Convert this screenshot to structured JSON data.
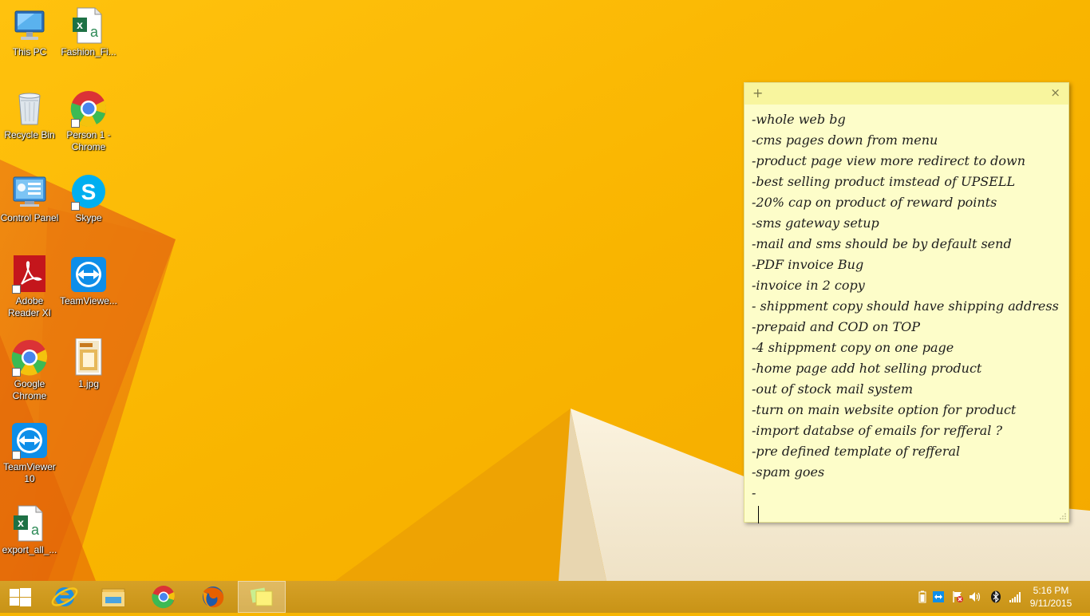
{
  "desktop_icons": [
    {
      "label": "This PC",
      "icon": "this-pc-icon"
    },
    {
      "label": "Fashion_Fi...",
      "icon": "excel-file-icon"
    },
    {
      "label": "Recycle Bin",
      "icon": "recycle-bin-icon"
    },
    {
      "label": "Person 1 - Chrome",
      "icon": "chrome-icon"
    },
    {
      "label": "Control Panel",
      "icon": "control-panel-icon"
    },
    {
      "label": "Skype",
      "icon": "skype-icon"
    },
    {
      "label": "Adobe Reader XI",
      "icon": "adobe-reader-icon"
    },
    {
      "label": "TeamViewe...",
      "icon": "teamviewer-icon"
    },
    {
      "label": "Google Chrome",
      "icon": "chrome-icon"
    },
    {
      "label": "1.jpg",
      "icon": "image-file-icon"
    },
    {
      "label": "TeamViewer 10",
      "icon": "teamviewer-icon"
    },
    {
      "label": "export_all_...",
      "icon": "excel-file-icon"
    }
  ],
  "sticky_note": {
    "add_glyph": "+",
    "close_glyph": "×",
    "lines": [
      "-whole web bg",
      "-cms pages down from menu",
      "-product page view more redirect to down",
      "-best selling product imstead of UPSELL",
      "-20% cap on product of reward points",
      "-sms gateway setup",
      "-mail and sms should be by default send",
      "-PDF invoice Bug",
      "-invoice in 2 copy",
      "- shippment copy should have shipping address",
      "-prepaid and COD on TOP",
      "-4 shippment copy on one page",
      "-home page add hot selling product",
      "-out of stock mail system",
      "-turn on main website option for product",
      "-import databse of emails for refferal ?",
      "-pre defined template of refferal",
      "-spam goes",
      "-"
    ]
  },
  "taskbar": {
    "pinned": [
      "start-button",
      "internet-explorer",
      "file-explorer",
      "google-chrome",
      "firefox",
      "sticky-notes"
    ],
    "active": "sticky-notes",
    "clock_time": "5:16 PM",
    "clock_date": "9/11/2015"
  },
  "colors": {
    "desktop": "#f7b500",
    "taskbar": "#cf9a1d",
    "sticky": "#fdfdc9"
  }
}
